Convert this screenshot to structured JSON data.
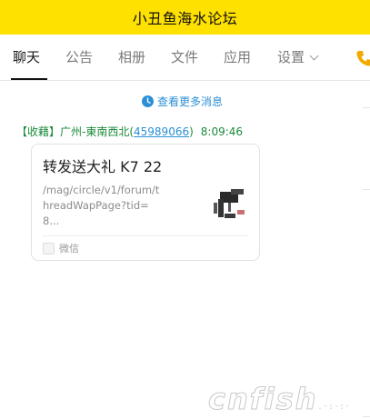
{
  "window": {
    "title": "小丑鱼海水论坛"
  },
  "tabs": [
    {
      "label": "聊天",
      "active": true
    },
    {
      "label": "公告",
      "active": false
    },
    {
      "label": "相册",
      "active": false
    },
    {
      "label": "文件",
      "active": false
    },
    {
      "label": "应用",
      "active": false
    },
    {
      "label": "设置",
      "active": false
    }
  ],
  "icons": {
    "phone": "phone-icon",
    "clock": "clock-icon",
    "settings_dropdown": "chevron-down-icon",
    "wechat": "wechat-icon"
  },
  "colors": {
    "titlebar_bg": "#ffe100",
    "link_blue": "#2c8fd6",
    "sender_green": "#1a8a3a"
  },
  "chat": {
    "more_messages_label": "查看更多消息",
    "message": {
      "sender_tag": "【收藉】广州-東南西北(",
      "sender_qq": "45989066",
      "sender_close": ")",
      "time": "8:09:46",
      "card": {
        "title": "转发送大礼 K7 22",
        "description": "/mag/circle/v1/forum/threadWapPage?tid=8...",
        "source": "微信"
      }
    }
  },
  "watermark": {
    "text": "cnfish"
  }
}
